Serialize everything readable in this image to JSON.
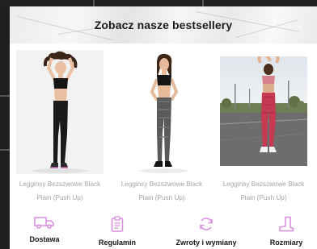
{
  "header": {
    "title_prefix": "Zobacz nasze ",
    "title_bold": "bestsellery"
  },
  "products": [
    {
      "name_line1": "Legginsy Bezszwowe Black",
      "name_line2": "Plain (Push Up)",
      "image": "woman-black-leggings-photo"
    },
    {
      "name_line1": "Legginsy Bezszwowe Black",
      "name_line2": "Plain (Push Up)",
      "image": "woman-grey-leggings-photo"
    },
    {
      "name_line1": "Legginsy Bezszwowe Black",
      "name_line2": "Plain (Push Up)",
      "image": "woman-red-leggings-photo"
    }
  ],
  "features": [
    {
      "label": "Dostawa",
      "icon": "truck-icon"
    },
    {
      "label": "Regulamin",
      "icon": "clipboard-icon"
    },
    {
      "label": "Zwroty i wymiany",
      "icon": "return-cycle-icon"
    },
    {
      "label": "Rozmiary",
      "icon": "boot-icon"
    }
  ],
  "colors": {
    "accent": "#d98be0",
    "text": "#161616",
    "muted": "#a4a4a4"
  }
}
